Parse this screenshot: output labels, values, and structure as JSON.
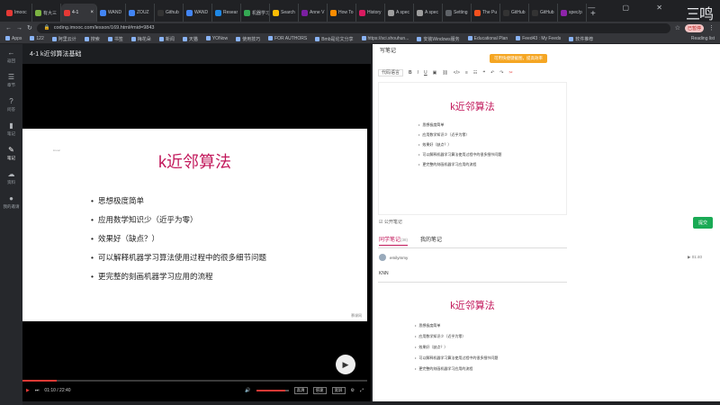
{
  "browser": {
    "tabs": [
      "Imooc",
      "有大三",
      "4-1",
      "WAND",
      "ZOUZ",
      "Github",
      "WAND",
      "Resear",
      "机器学习",
      "Search",
      "Anne V",
      "How To",
      "History",
      "A spec",
      "A spec",
      "Setting",
      "The Pu",
      "GitHub",
      "GitHub",
      "spec/p"
    ],
    "tab_colors": [
      "#e53935",
      "#7cb342",
      "#e53935",
      "#4285f4",
      "#4285f4",
      "#333333",
      "#4285f4",
      "#1e88e5",
      "#34a853",
      "#fbbc04",
      "#7b1fa2",
      "#fb8c00",
      "#d81b60",
      "#9e9e9e",
      "#9e9e9e",
      "#5f6368",
      "#f4511e",
      "#333333",
      "#333333",
      "#8e24aa"
    ],
    "url": "coding.imooc.com/lesson/169.html#mid=9843",
    "badge": "已暂停",
    "bookmarks": [
      "Apps",
      "122",
      "阿里云计",
      "搜索",
      "书签",
      "梅花朵",
      "新闻",
      "天猫",
      "YONow",
      "使用技巧",
      "FOR AUTHORS",
      "Bmb是论文分享",
      "https://sci.shouhun...",
      "安装Windows服务",
      "Educational Plan",
      "Feed43 : My Feeds",
      "软件推荐"
    ],
    "reading_list": "Reading list",
    "corner_logo": "三鸣"
  },
  "sidebar": {
    "items": [
      {
        "icon": "←",
        "label": "返回"
      },
      {
        "icon": "☰",
        "label": "章节"
      },
      {
        "icon": "?",
        "label": "问答"
      },
      {
        "icon": "▮",
        "label": "笔记"
      },
      {
        "icon": "✎",
        "label": "笔记"
      },
      {
        "icon": "☁",
        "label": "资料"
      },
      {
        "icon": "●",
        "label": "我的邀请"
      }
    ]
  },
  "video": {
    "lesson_title": "4-1 k近邻算法基础",
    "slide": {
      "small_mark": "imooc",
      "title": "k近邻算法",
      "bullets": [
        "思想极度简单",
        "应用数学知识少（近乎为零）",
        "效果好（缺点？）",
        "可以解释机器学习算法使用过程中的很多细节问题",
        "更完整的刻画机器学习应用的流程"
      ],
      "watermark": "慕课网"
    },
    "progress": 0.1,
    "volume": 0.9,
    "time": "01:10 / 22:40",
    "quality": "高清",
    "speed": "倍速",
    "fullscreen_label": "宽屏"
  },
  "notes": {
    "header": "写笔记",
    "hint": "可用快捷键截图，提高效率",
    "toolbar": {
      "format": "代码语言",
      "bold": "B",
      "italic": "I",
      "underline": "U"
    },
    "editor": {
      "title": "k近邻算法",
      "bullets": [
        "思想极度简单",
        "应用数学知识少（近乎为零）",
        "效果好（缺点？）",
        "可以解释机器学习算法使用过程中的很多细节问题",
        "更完整的刻画机器学习应用的流程"
      ]
    },
    "public_label": "公开笔记",
    "submit": "提交",
    "tabs": [
      {
        "label": "同学笔记",
        "count": "(38)"
      },
      {
        "label": "我的笔记",
        "count": ""
      }
    ],
    "user": "emilymmy",
    "timestamp": "01:40",
    "note_keyword": "KNN",
    "card": {
      "title": "k近邻算法",
      "bullets": [
        "思想极度简单",
        "应用数学知识少（近乎为零）",
        "效果好（缺点？）",
        "可以解释机器学习算法使用过程中的很多细节问题",
        "更完整的刻画机器学习应用的流程"
      ]
    }
  }
}
